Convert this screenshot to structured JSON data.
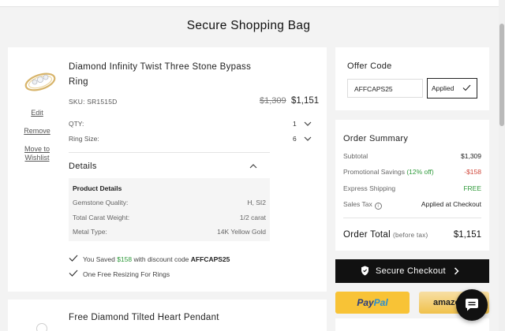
{
  "page": {
    "title": "Secure Shopping Bag"
  },
  "item1": {
    "name": "Diamond Infinity Twist Three Stone Bypass Ring",
    "sku": "SKU: SR1515D",
    "old_price": "$1,309",
    "new_price": "$1,151",
    "qty_label": "QTY:",
    "qty_value": "1",
    "ring_size_label": "Ring Size:",
    "ring_size_value": "6",
    "links": {
      "edit": "Edit",
      "remove": "Remove",
      "move": "Move to Wishlist"
    },
    "details": {
      "title": "Details",
      "box_title": "Product Details",
      "rows": [
        {
          "label": "Gemstone Quality:",
          "value": "H, SI2"
        },
        {
          "label": "Total Carat Weight:",
          "value": "1/2 carat"
        },
        {
          "label": "Metal Type:",
          "value": "14K Yellow Gold"
        }
      ]
    },
    "benefits": {
      "saved_prefix": "You Saved",
      "saved_amount": "$158",
      "saved_mid": "with discount code",
      "saved_code": "AFFCAPS25",
      "resizing": "One Free Resizing For Rings"
    }
  },
  "item2": {
    "name": "Free Diamond Tilted Heart Pendant"
  },
  "offer": {
    "title": "Offer Code",
    "code": "AFFCAPS25",
    "applied_label": "Applied"
  },
  "summary": {
    "title": "Order Summary",
    "rows": [
      {
        "label": "Subtotal",
        "value": "$1,309"
      },
      {
        "label_prefix": "Promotional Savings",
        "label_pct": "(12% off)",
        "value": "-$158"
      },
      {
        "label": "Express Shipping",
        "value": "FREE"
      },
      {
        "label": "Sales Tax",
        "value": "Applied at Checkout"
      }
    ],
    "total_label": "Order Total",
    "total_sub": "(before tax)",
    "total_value": "$1,151"
  },
  "checkout": {
    "label": "Secure Checkout"
  },
  "payments": {
    "paypal_a": "Pay",
    "paypal_b": "Pal",
    "amazon": "amazon"
  },
  "colors": {
    "green": "#2f9a3b",
    "red": "#d0473a",
    "paypal_yellow": "#f8c336",
    "checkout_black": "#111111"
  },
  "icons": [
    "ring-thumbnail",
    "chevron-down-icon",
    "chevron-up-icon",
    "check-icon",
    "info-icon",
    "shield-icon",
    "arrow-right-icon",
    "chat-icon"
  ]
}
